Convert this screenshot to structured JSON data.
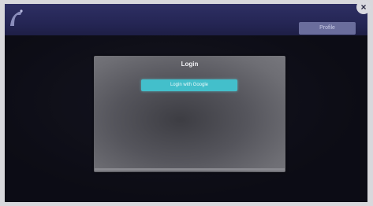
{
  "topbar": {
    "logo_icon": "brand-logo-icon",
    "title": "",
    "action_label": "Profile",
    "close_icon": "close-icon"
  },
  "login_modal": {
    "title": "Login",
    "google_button_label": "Login with Google"
  },
  "colors": {
    "topbar": "#2b2c5e",
    "modal_bg": "#5a5a60",
    "button_accent": "#43bfcb",
    "page_bg": "#0b0b12"
  }
}
